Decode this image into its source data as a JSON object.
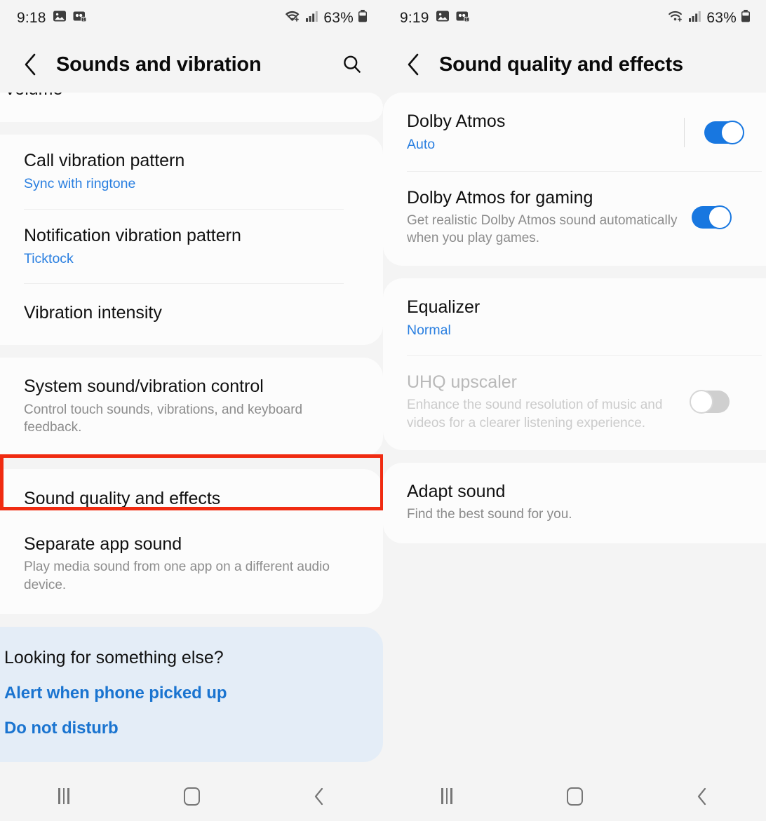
{
  "left_phone": {
    "status_bar": {
      "time": "9:18",
      "battery_percent": "63%",
      "icons": [
        "image-icon",
        "screen-recorder-icon",
        "wifi-icon",
        "signal-icon",
        "battery-icon"
      ]
    },
    "header": {
      "back_label": "back-chevron",
      "title": "Sounds and vibration",
      "search_label": "Search"
    },
    "partial_item": {
      "title": "Volume"
    },
    "vibration_card": [
      {
        "title": "Call vibration pattern",
        "sub": "Sync with ringtone",
        "sub_accent": true
      },
      {
        "title": "Notification vibration pattern",
        "sub": "Ticktock",
        "sub_accent": true
      },
      {
        "title": "Vibration intensity",
        "sub": "",
        "sub_accent": false
      }
    ],
    "system_card": [
      {
        "title": "System sound/vibration control",
        "sub": "Control touch sounds, vibrations, and keyboard feedback.",
        "sub_accent": false
      }
    ],
    "quality_card": [
      {
        "title": "Sound quality and effects",
        "sub": "",
        "sub_accent": false,
        "highlighted": true
      },
      {
        "title": "Separate app sound",
        "sub": "Play media sound from one app on a different audio device.",
        "sub_accent": false,
        "highlighted": false
      }
    ],
    "tip_card": {
      "title": "Looking for something else?",
      "links": [
        "Alert when phone picked up",
        "Do not disturb"
      ]
    },
    "nav": {
      "recents": "recents-button",
      "home": "home-button",
      "back": "back-button"
    }
  },
  "right_phone": {
    "status_bar": {
      "time": "9:19",
      "battery_percent": "63%",
      "icons": [
        "image-icon",
        "screen-recorder-icon",
        "wifi-icon",
        "signal-icon",
        "battery-icon"
      ]
    },
    "header": {
      "back_label": "back-chevron",
      "title": "Sound quality and effects"
    },
    "dolby_card": [
      {
        "title": "Dolby Atmos",
        "sub": "Auto",
        "sub_accent": true,
        "toggle": "on",
        "has_separator": true,
        "disabled": false
      },
      {
        "title": "Dolby Atmos for gaming",
        "sub": "Get realistic Dolby Atmos sound automatically when you play games.",
        "sub_accent": false,
        "toggle": "on",
        "has_separator": false,
        "disabled": false
      }
    ],
    "equalizer_card": [
      {
        "title": "Equalizer",
        "sub": "Normal",
        "sub_accent": true,
        "toggle": "none",
        "has_separator": false,
        "disabled": false
      },
      {
        "title": "UHQ upscaler",
        "sub": "Enhance the sound resolution of music and videos for a clearer listening experience.",
        "sub_accent": false,
        "toggle": "off",
        "has_separator": false,
        "disabled": true
      }
    ],
    "adapt_card": [
      {
        "title": "Adapt sound",
        "sub": "Find the best sound for you.",
        "sub_accent": false,
        "toggle": "none",
        "has_separator": false,
        "disabled": false
      }
    ],
    "nav": {
      "recents": "recents-button",
      "home": "home-button",
      "back": "back-button"
    }
  },
  "colors": {
    "accent_blue": "#2a7fe0",
    "link_blue": "#1a74d0",
    "toggle_on": "#1877e0",
    "highlight_red": "#f02b11",
    "tip_card_bg": "#e4edf7"
  }
}
